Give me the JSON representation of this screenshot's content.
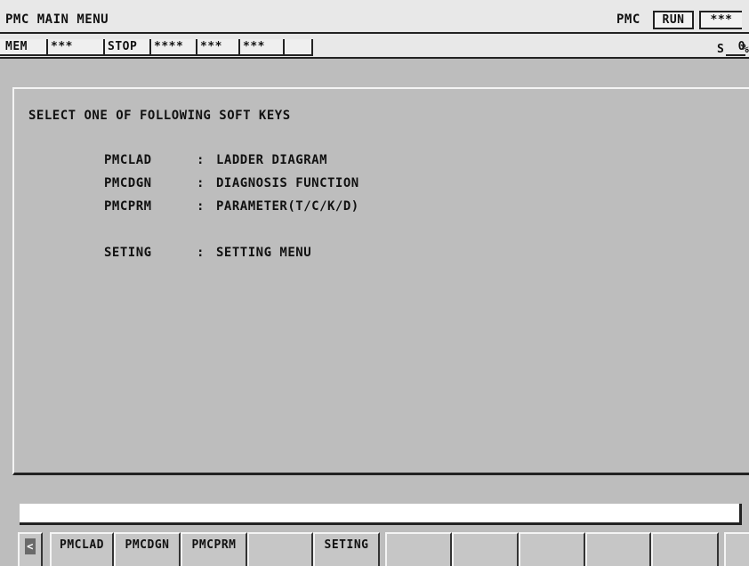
{
  "title": "PMC MAIN MENU",
  "pmc_label": "PMC",
  "pmc_state": "RUN",
  "pmc_stars": "***",
  "status": {
    "mode": "MEM",
    "field1": "***",
    "state": "STOP",
    "field2": "****",
    "field3": "***",
    "field4": "***",
    "field5": "",
    "spindle_label": "S",
    "spindle_value": "0",
    "percent": "%"
  },
  "main": {
    "heading": "SELECT ONE OF FOLLOWING SOFT KEYS",
    "items": [
      {
        "key": "PMCLAD",
        "sep": ":",
        "desc": "LADDER DIAGRAM"
      },
      {
        "key": "PMCDGN",
        "sep": ":",
        "desc": "DIAGNOSIS FUNCTION"
      },
      {
        "key": "PMCPRM",
        "sep": ":",
        "desc": "PARAMETER(T/C/K/D)"
      },
      {
        "key": "SETING",
        "sep": ":",
        "desc": "SETTING MENU"
      }
    ]
  },
  "input_value": "",
  "softkeys": {
    "prev_icon": "left-arrow-icon",
    "prev": "<",
    "labels": [
      "PMCLAD",
      "PMCDGN",
      "PMCPRM",
      "",
      "SETING",
      "",
      "",
      "",
      "",
      "",
      ""
    ]
  }
}
